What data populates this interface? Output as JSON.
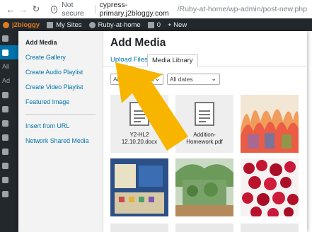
{
  "browser": {
    "back_glyph": "←",
    "forward_glyph": "→",
    "reload_glyph": "↻",
    "security_label": "Not secure",
    "url_host": "cypress-primary.j2bloggy.com",
    "url_path": "/Ruby-at-home/wp-admin/post-new.php"
  },
  "adminbar": {
    "logo": "j2bloggy",
    "my_sites": "My Sites",
    "site_name": "Ruby-at-home",
    "comments_count": "0",
    "new_label": "+ New"
  },
  "wp_menu_labels": [
    "All",
    "Ad"
  ],
  "side_menu": {
    "items": [
      {
        "label": "Add Media",
        "current": true
      },
      {
        "label": "Create Gallery"
      },
      {
        "label": "Create Audio Playlist"
      },
      {
        "label": "Create Video Playlist"
      },
      {
        "label": "Featured Image"
      }
    ],
    "items2": [
      {
        "label": "Insert from URL"
      },
      {
        "label": "Network Shared Media"
      }
    ]
  },
  "modal": {
    "title": "Add Media",
    "tabs": {
      "upload": "Upload Files",
      "library": "Media Library"
    },
    "filters": {
      "type_value": "All media items",
      "date_value": "All dates"
    },
    "files": [
      {
        "name_line1": "Y2-HL2",
        "name_line2": "12.10.20.docx",
        "icon": "document-icon"
      },
      {
        "name_line1": "Addition-",
        "name_line2": "Homework.pdf",
        "icon": "document-icon"
      }
    ]
  },
  "colors": {
    "admin_dark": "#23282d",
    "link_blue": "#0073aa",
    "arrow_yellow": "#f7b500"
  }
}
